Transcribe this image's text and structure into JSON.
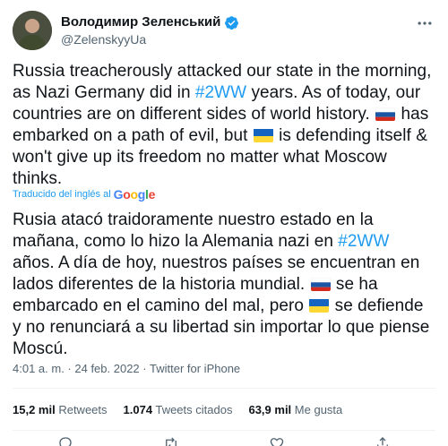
{
  "author": {
    "display_name": "Володимир Зеленський",
    "handle": "@ZelenskyyUa",
    "verified": true
  },
  "tweet": {
    "en_1": "Russia treacherously attacked our state in the morning, as Nazi Germany did in ",
    "en_hashtag": "#2WW",
    "en_2": " years. As of today, our countries are on different sides of world history. ",
    "en_3": " has embarked on a path of evil, but ",
    "en_4": " is defending itself & won't give up its freedom no matter what Moscow thinks."
  },
  "translation": {
    "label": "Traducido del inglés al",
    "provider": "Google",
    "es_1": "Rusia atacó traidoramente nuestro estado en la mañana, como lo hizo la Alemania nazi en ",
    "es_hashtag": "#2WW",
    "es_2": " años. A día de hoy, nuestros países se encuentran en lados diferentes de la historia mundial. ",
    "es_3": " se ha embarcado en el camino del mal, pero ",
    "es_4": " se defiende y no renunciará a su libertad sin importar lo que piense Moscú."
  },
  "meta": {
    "time": "4:01 a. m.",
    "separator": " · ",
    "date": "24 feb. 2022",
    "source": "Twitter for iPhone"
  },
  "stats": {
    "retweets_count": "15,2 mil",
    "retweets_label": "Retweets",
    "quotes_count": "1.074",
    "quotes_label": "Tweets citados",
    "likes_count": "63,9 mil",
    "likes_label": "Me gusta"
  },
  "icons": [
    "verified-badge-icon",
    "more-options-icon",
    "russia-flag-icon",
    "ukraine-flag-icon",
    "reply-icon",
    "retweet-icon",
    "like-icon",
    "share-icon"
  ],
  "colors": {
    "link": "#1d9bf0",
    "secondary": "#536471",
    "text": "#0f1419"
  }
}
